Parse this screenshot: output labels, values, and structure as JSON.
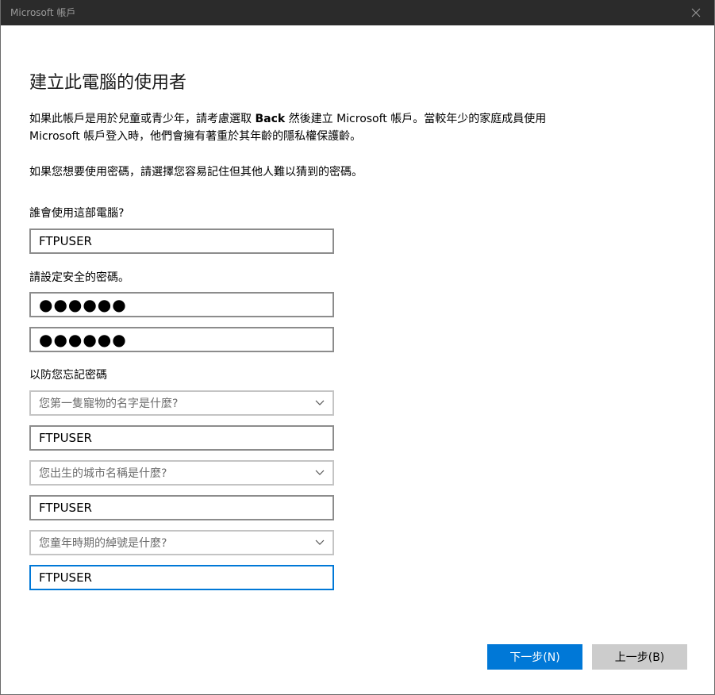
{
  "window": {
    "title": "Microsoft 帳戶"
  },
  "page": {
    "title": "建立此電腦的使用者",
    "intro_part1": "如果此帳戶是用於兒童或青少年，請考慮選取 ",
    "intro_bold": "Back",
    "intro_part2": " 然後建立 Microsoft 帳戶。當較年少的家庭成員使用 Microsoft 帳戶登入時，他們會擁有著重於其年齡的隱私權保護齡。",
    "password_hint": "如果您想要使用密碼，請選擇您容易記住但其他人難以猜到的密碼。"
  },
  "form": {
    "username_label": "誰會使用這部電腦?",
    "username_value": "FTPUSER",
    "password_label": "請設定安全的密碼。",
    "password_mask": "●●●●●●",
    "password_confirm_mask": "●●●●●●",
    "security_label": "以防您忘記密碼",
    "questions": [
      {
        "question": "您第一隻寵物的名字是什麼?",
        "answer": "FTPUSER"
      },
      {
        "question": "您出生的城市名稱是什麼?",
        "answer": "FTPUSER"
      },
      {
        "question": "您童年時期的綽號是什麼?",
        "answer": "FTPUSER"
      }
    ]
  },
  "buttons": {
    "next": "下一步(N)",
    "back": "上一步(B)"
  },
  "icons": {
    "close": "close-icon",
    "dropdown": "chevron-down-icon"
  },
  "colors": {
    "accent": "#0078d7",
    "titlebar": "#2b2b2b",
    "secondary_button": "#cccccc"
  }
}
